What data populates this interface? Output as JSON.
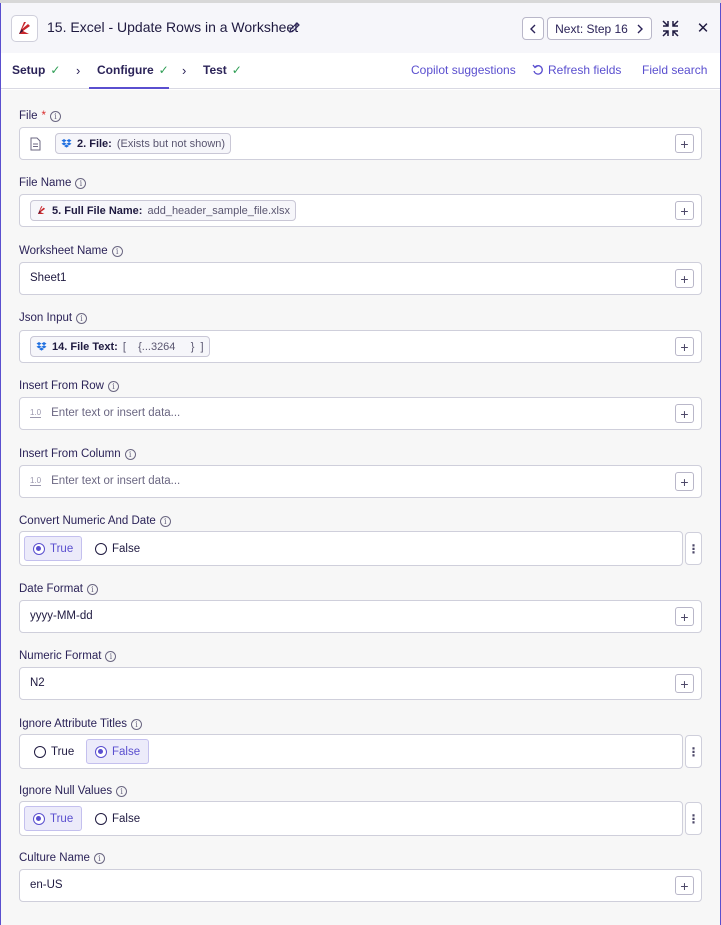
{
  "header": {
    "title": "15. Excel - Update Rows in a Worksheet",
    "next_label": "Next: Step 16"
  },
  "tabs": [
    {
      "label": "Setup"
    },
    {
      "label": "Configure"
    },
    {
      "label": "Test"
    }
  ],
  "actions": {
    "copilot": "Copilot suggestions",
    "refresh": "Refresh fields",
    "search": "Field search"
  },
  "fields": {
    "file": {
      "label": "File",
      "required": "*",
      "pill_key": "2. File:",
      "pill_value": "(Exists but not shown)"
    },
    "file_name": {
      "label": "File Name",
      "pill_key": "5. Full File Name:",
      "pill_value": "add_header_sample_file.xlsx"
    },
    "worksheet_name": {
      "label": "Worksheet Name",
      "value": "Sheet1"
    },
    "json_input": {
      "label": "Json Input",
      "pill_key": "14. File Text:",
      "pill_value": "[    {...3264     }  ]"
    },
    "insert_from_row": {
      "label": "Insert From Row",
      "placeholder": "Enter text or insert data..."
    },
    "insert_from_column": {
      "label": "Insert From Column",
      "placeholder": "Enter text or insert data..."
    },
    "convert_numeric_and_date": {
      "label": "Convert Numeric And Date",
      "options": [
        "True",
        "False"
      ],
      "selected": "True"
    },
    "date_format": {
      "label": "Date Format",
      "value": "yyyy-MM-dd"
    },
    "numeric_format": {
      "label": "Numeric Format",
      "value": "N2"
    },
    "ignore_attribute_titles": {
      "label": "Ignore Attribute Titles",
      "options": [
        "True",
        "False"
      ],
      "selected": "False"
    },
    "ignore_null_values": {
      "label": "Ignore Null Values",
      "options": [
        "True",
        "False"
      ],
      "selected": "True"
    },
    "culture_name": {
      "label": "Culture Name",
      "value": "en-US"
    }
  },
  "icons": {
    "app": "mulesoft-red-logo-icon",
    "dropbox": "dropbox-icon",
    "plus": "plus-icon",
    "kebab": "more-vertical-icon"
  },
  "colors": {
    "accent": "#5a4fcf",
    "success": "#2f9e55",
    "required": "#d92b2b",
    "brand_red": "#c8262b"
  }
}
